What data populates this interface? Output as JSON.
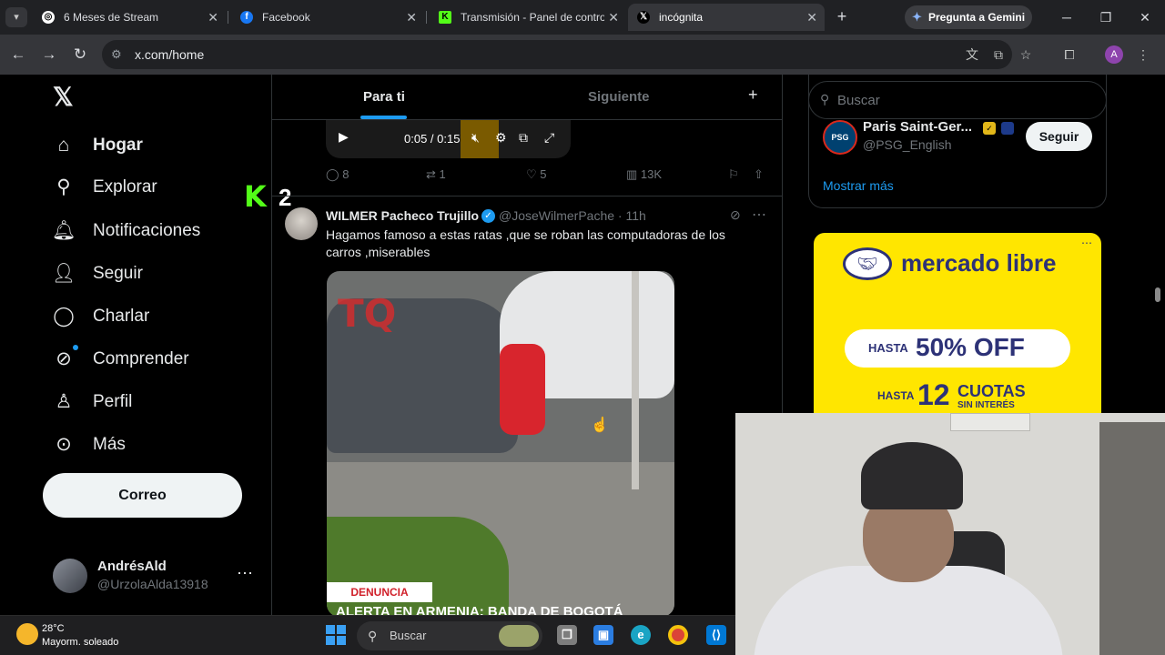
{
  "browser": {
    "tabs": [
      {
        "label": "6 Meses de Stream",
        "icon": "chatgpt-icon"
      },
      {
        "label": "Facebook",
        "icon": "facebook-icon"
      },
      {
        "label": "Transmisión - Panel de control",
        "icon": "kick-icon"
      },
      {
        "label": "incógnita",
        "icon": "x-icon"
      }
    ],
    "gemini_label": "Pregunta a Gemini",
    "url": "x.com/home",
    "profile_initial": "A"
  },
  "sidebar": {
    "items": [
      {
        "label": "Hogar",
        "icon": "home-icon"
      },
      {
        "label": "Explorar",
        "icon": "search-icon"
      },
      {
        "label": "Notificaciones",
        "icon": "bell-icon"
      },
      {
        "label": "Seguir",
        "icon": "follow-icon"
      },
      {
        "label": "Charlar",
        "icon": "chat-icon"
      },
      {
        "label": "Comprender",
        "icon": "grok-icon"
      },
      {
        "label": "Perfil",
        "icon": "person-icon"
      },
      {
        "label": "Más",
        "icon": "more-circle-icon"
      }
    ],
    "post_button": "Correo",
    "user": {
      "name": "AndrésAld",
      "handle": "@UrzolaAlda13918"
    }
  },
  "overlay": {
    "k_letter": "K",
    "k_number": "2"
  },
  "feed": {
    "tabs": {
      "for_you": "Para ti",
      "following": "Siguiente"
    },
    "video": {
      "time": "0:05 / 0:15"
    },
    "prev_actions": {
      "replies": "8",
      "reposts": "1",
      "likes": "5",
      "views": "13K"
    },
    "tweet": {
      "name": "WILMER Pacheco Trujillo",
      "handle": "@JoseWilmerPache · 11h",
      "text": "Hagamos famoso a estas ratas ,que se roban las computadoras de los carros ,miserables",
      "image_logo": "TQ",
      "image_badge": "DENUNCIA",
      "image_headline": "ALERTA EN ARMENIA: BANDA DE BOGOTÁ"
    }
  },
  "right": {
    "search_placeholder": "Buscar",
    "suggestion": {
      "name": "Paris Saint-Ger...",
      "handle": "@PSG_English",
      "button": "Seguir"
    },
    "show_more": "Mostrar más",
    "ad": {
      "brand": "mercado libre",
      "hasta1": "HASTA",
      "discount": "50% OFF",
      "hasta2": "HASTA",
      "cuotas_num": "12",
      "cuotas": "CUOTAS",
      "sin_interes": "SIN INTERÉS"
    }
  },
  "taskbar": {
    "temp": "28°C",
    "weather": "Mayorm. soleado",
    "search": "Buscar"
  },
  "colors": {
    "accent": "#1d9bf0",
    "kick": "#53fc18",
    "ad_yellow": "#ffe600",
    "ad_blue": "#2d3277"
  }
}
